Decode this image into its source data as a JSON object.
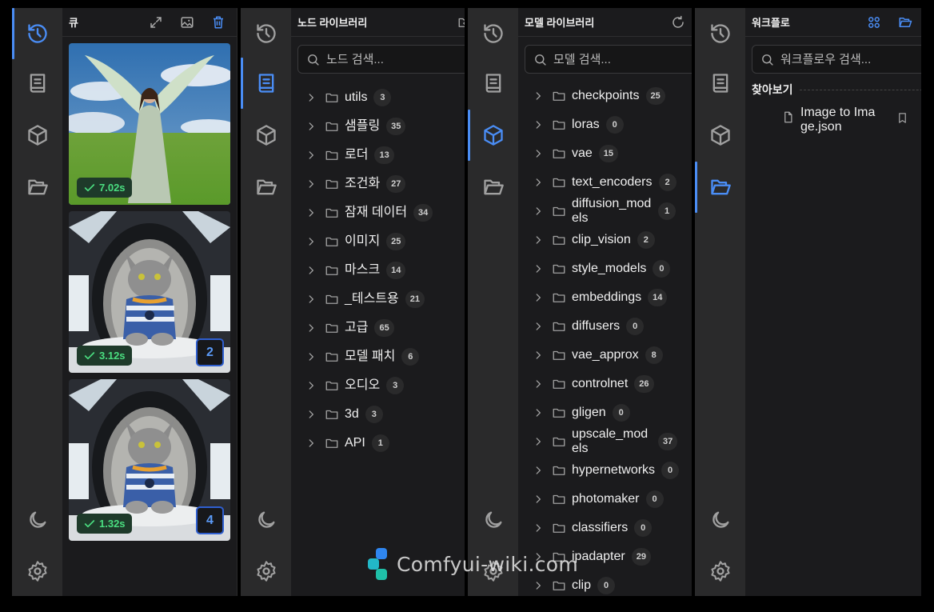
{
  "colors": {
    "accent": "#4a8df5",
    "success": "#4ade80",
    "panel_bg": "#1b1b1d",
    "rail_bg": "#2a2a2b"
  },
  "rail_icons": [
    "history-icon",
    "book-icon",
    "cube-icon",
    "folder-open-icon",
    "moon-icon",
    "gear-icon"
  ],
  "queue": {
    "title": "큐",
    "actions": [
      "expand-icon",
      "image-icon",
      "trash-icon"
    ],
    "items": [
      {
        "subject": "angel in meadow",
        "time": "7.02s",
        "count": null
      },
      {
        "subject": "cat in space pod",
        "time": "3.12s",
        "count": "2"
      },
      {
        "subject": "cat in space pod",
        "time": "1.32s",
        "count": "4"
      }
    ]
  },
  "node_library": {
    "title": "노드 라이브러리",
    "search_placeholder": "노드 검색...",
    "items": [
      {
        "label": "utils",
        "count": "3"
      },
      {
        "label": "샘플링",
        "count": "35"
      },
      {
        "label": "로더",
        "count": "13"
      },
      {
        "label": "조건화",
        "count": "27"
      },
      {
        "label": "잠재 데이터",
        "count": "34"
      },
      {
        "label": "이미지",
        "count": "25"
      },
      {
        "label": "마스크",
        "count": "14"
      },
      {
        "label": "_테스트용",
        "count": "21"
      },
      {
        "label": "고급",
        "count": "65"
      },
      {
        "label": "모델 패치",
        "count": "6"
      },
      {
        "label": "오디오",
        "count": "3"
      },
      {
        "label": "3d",
        "count": "3"
      },
      {
        "label": "API",
        "count": "1"
      }
    ]
  },
  "model_library": {
    "title": "모델 라이브러리",
    "search_placeholder": "모델 검색...",
    "items": [
      {
        "label": "checkpoints",
        "count": "25"
      },
      {
        "label": "loras",
        "count": "0"
      },
      {
        "label": "vae",
        "count": "15"
      },
      {
        "label": "text_encoders",
        "count": "2"
      },
      {
        "label": "diffusion_models",
        "count": "1"
      },
      {
        "label": "clip_vision",
        "count": "2"
      },
      {
        "label": "style_models",
        "count": "0"
      },
      {
        "label": "embeddings",
        "count": "14"
      },
      {
        "label": "diffusers",
        "count": "0"
      },
      {
        "label": "vae_approx",
        "count": "8"
      },
      {
        "label": "controlnet",
        "count": "26"
      },
      {
        "label": "gligen",
        "count": "0"
      },
      {
        "label": "upscale_models",
        "count": "37"
      },
      {
        "label": "hypernetworks",
        "count": "0"
      },
      {
        "label": "photomaker",
        "count": "0"
      },
      {
        "label": "classifiers",
        "count": "0"
      },
      {
        "label": "ipadapter",
        "count": "29"
      },
      {
        "label": "clip",
        "count": "0"
      }
    ]
  },
  "workflow": {
    "title": "워크플로",
    "search_placeholder": "워크플로우 검색...",
    "section": "찾아보기",
    "files": [
      {
        "label": "Image to Image.json"
      }
    ]
  },
  "watermark": "Comfyui-wiki.com"
}
